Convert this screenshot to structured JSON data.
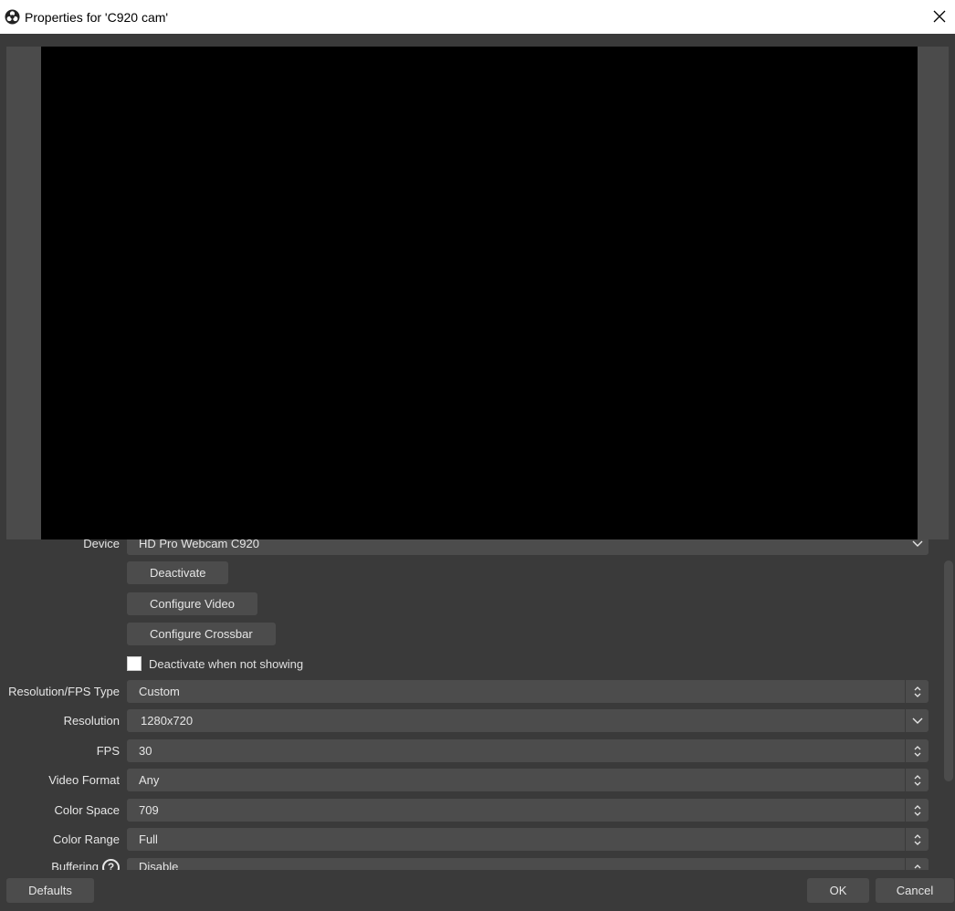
{
  "window": {
    "title": "Properties for 'C920 cam'",
    "app_icon": "obs-logo-icon",
    "close_icon": "close-icon"
  },
  "colors": {
    "background": "#3a3a3a",
    "field": "#4c4c4c",
    "preview_frame": "#4b4b4b",
    "preview_video": "#000000",
    "text": "#e6e6e6"
  },
  "properties": {
    "device": {
      "label": "Device",
      "value": "HD Pro Webcam C920"
    },
    "deactivate_label": "Deactivate",
    "configure_video_label": "Configure Video",
    "configure_crossbar_label": "Configure Crossbar",
    "deactivate_when_not_showing": {
      "label": "Deactivate when not showing",
      "checked": false
    },
    "resolution_fps_type": {
      "label": "Resolution/FPS Type",
      "value": "Custom"
    },
    "resolution": {
      "label": "Resolution",
      "value": "1280x720"
    },
    "fps": {
      "label": "FPS",
      "value": "30"
    },
    "video_format": {
      "label": "Video Format",
      "value": "Any"
    },
    "color_space": {
      "label": "Color Space",
      "value": "709"
    },
    "color_range": {
      "label": "Color Range",
      "value": "Full"
    },
    "buffering": {
      "label": "Buffering",
      "value": "Disable",
      "help_glyph": "?"
    }
  },
  "footer": {
    "defaults_label": "Defaults",
    "ok_label": "OK",
    "cancel_label": "Cancel"
  }
}
